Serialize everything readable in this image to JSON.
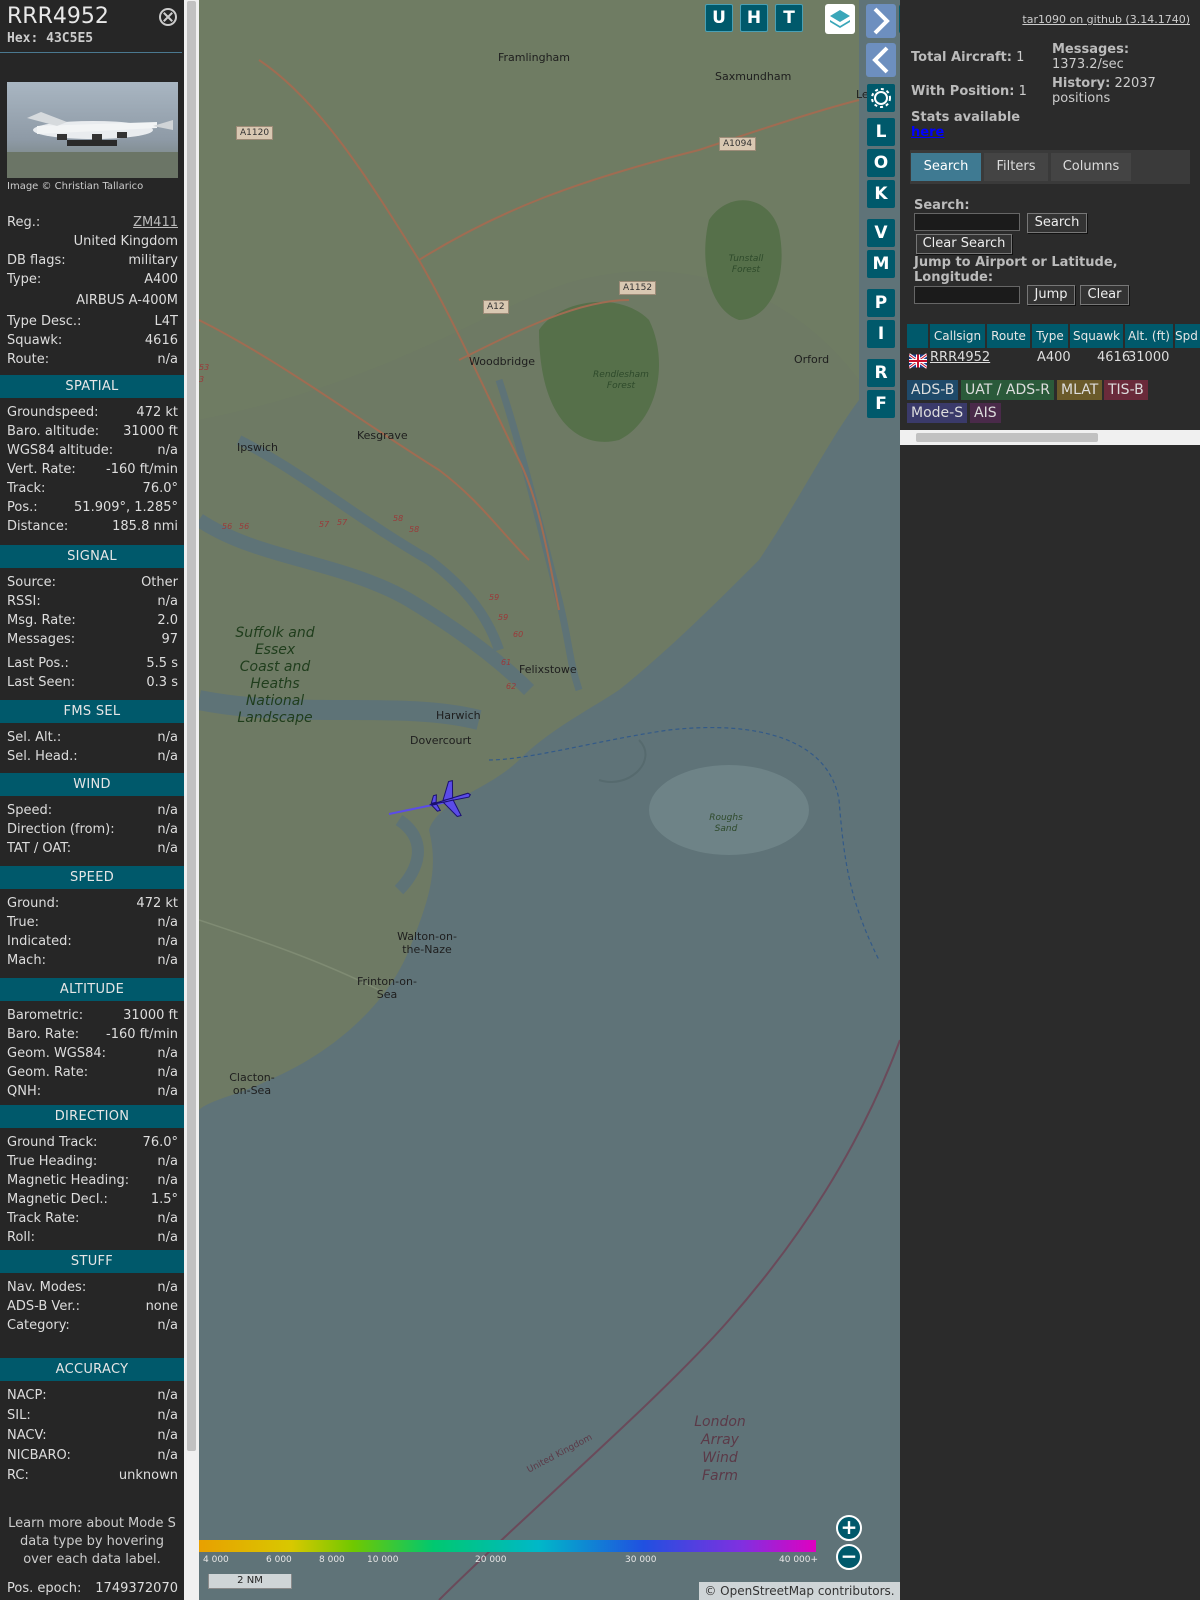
{
  "aircraft": {
    "callsign": "RRR4952",
    "hex_label": "Hex:",
    "hex": "43C5E5",
    "photo_credit": "Image © Christian Tallarico",
    "details": [
      {
        "label": "Reg.:",
        "value": "ZM411",
        "link": true
      },
      {
        "label": "",
        "value": "United Kingdom"
      },
      {
        "label": "DB flags:",
        "value": "military"
      },
      {
        "label": "Type:",
        "value": "A400"
      },
      {
        "label": "",
        "value": "AIRBUS A-400M"
      },
      {
        "label": "Type Desc.:",
        "value": "L4T"
      },
      {
        "label": "Squawk:",
        "value": "4616"
      },
      {
        "label": "Route:",
        "value": "n/a"
      }
    ],
    "sections": [
      {
        "title": "SPATIAL",
        "rows": [
          {
            "label": "Groundspeed:",
            "value": "472 kt"
          },
          {
            "label": "Baro. altitude:",
            "value": "31000 ft"
          },
          {
            "label": "WGS84 altitude:",
            "value": "n/a"
          },
          {
            "label": "Vert. Rate:",
            "value": "-160 ft/min"
          },
          {
            "label": "Track:",
            "value": "76.0°"
          },
          {
            "label": "Pos.:",
            "value": "51.909°, 1.285°"
          },
          {
            "label": "Distance:",
            "value": "185.8 nmi"
          }
        ]
      },
      {
        "title": "SIGNAL",
        "rows": [
          {
            "label": "Source:",
            "value": "Other"
          },
          {
            "label": "RSSI:",
            "value": "n/a"
          },
          {
            "label": "Msg. Rate:",
            "value": "2.0"
          },
          {
            "label": "Messages:",
            "value": "97"
          },
          {
            "label": "Last Pos.:",
            "value": "5.5 s"
          },
          {
            "label": "Last Seen:",
            "value": "0.3 s"
          }
        ]
      },
      {
        "title": "FMS SEL",
        "rows": [
          {
            "label": "Sel. Alt.:",
            "value": "n/a"
          },
          {
            "label": "Sel. Head.:",
            "value": "n/a"
          }
        ]
      },
      {
        "title": "WIND",
        "rows": [
          {
            "label": "Speed:",
            "value": "n/a"
          },
          {
            "label": "Direction (from):",
            "value": "n/a"
          },
          {
            "label": "TAT / OAT:",
            "value": "n/a"
          }
        ]
      },
      {
        "title": "SPEED",
        "rows": [
          {
            "label": "Ground:",
            "value": "472 kt"
          },
          {
            "label": "True:",
            "value": "n/a"
          },
          {
            "label": "Indicated:",
            "value": "n/a"
          },
          {
            "label": "Mach:",
            "value": "n/a"
          }
        ]
      },
      {
        "title": "ALTITUDE",
        "rows": [
          {
            "label": "Barometric:",
            "value": "31000 ft"
          },
          {
            "label": "Baro. Rate:",
            "value": "-160 ft/min"
          },
          {
            "label": "Geom. WGS84:",
            "value": "n/a"
          },
          {
            "label": "Geom. Rate:",
            "value": "n/a"
          },
          {
            "label": "QNH:",
            "value": "n/a"
          }
        ]
      },
      {
        "title": "DIRECTION",
        "rows": [
          {
            "label": "Ground Track:",
            "value": "76.0°"
          },
          {
            "label": "True Heading:",
            "value": "n/a"
          },
          {
            "label": "Magnetic Heading:",
            "value": "n/a"
          },
          {
            "label": "Magnetic Decl.:",
            "value": "1.5°"
          },
          {
            "label": "Track Rate:",
            "value": "n/a"
          },
          {
            "label": "Roll:",
            "value": "n/a"
          }
        ]
      },
      {
        "title": "STUFF",
        "rows": [
          {
            "label": "Nav. Modes:",
            "value": "n/a"
          },
          {
            "label": "ADS-B Ver.:",
            "value": "none"
          },
          {
            "label": "Category:",
            "value": "n/a"
          }
        ]
      },
      {
        "title": "ACCURACY",
        "rows": [
          {
            "label": "NACP:",
            "value": "n/a"
          },
          {
            "label": "SIL:",
            "value": "n/a"
          },
          {
            "label": "NACV:",
            "value": "n/a"
          },
          {
            "label": "NICBARO:",
            "value": "n/a"
          },
          {
            "label": "RC:",
            "value": "unknown"
          }
        ]
      }
    ],
    "learn_more": "Learn more about Mode S data type by hovering over each data label.",
    "pos_epoch_label": "Pos. epoch:",
    "pos_epoch": "1749372070"
  },
  "map": {
    "buttons": [
      "U",
      "H",
      "T"
    ],
    "side_buttons": [
      "L",
      "O",
      "K",
      "V",
      "M",
      "P",
      "I",
      "R",
      "F"
    ],
    "places": [
      "Framlingham",
      "Saxmundham",
      "Le",
      "Woodbridge",
      "Orford",
      "Kesgrave",
      "Ipswich",
      "Felixstowe",
      "Harwich",
      "Dovercourt",
      "Walton-on-the-Naze",
      "Frinton-on-Sea",
      "Clacton-on-Sea"
    ],
    "forests": [
      "Tunstall Forest",
      "Rendlesham Forest",
      "Roughs Sand"
    ],
    "aonb": "Suffolk and Essex Coast and Heaths National Landscape",
    "wind_farm": "London Array Wind Farm",
    "border": "United Kingdom",
    "roads": [
      "A1120",
      "A1094",
      "A12",
      "A1152"
    ],
    "junctions": [
      "56",
      "56",
      "57",
      "57",
      "58",
      "58",
      "59",
      "59",
      "60",
      "61",
      "62",
      "53",
      "3"
    ],
    "altitude_ticks": [
      "4 000",
      "6 000",
      "8 000",
      "10 000",
      "20 000",
      "30 000",
      "40 000+"
    ],
    "scale": "2 NM",
    "attribution": "© OpenStreetMap contributors."
  },
  "panel": {
    "github": "tar1090 on github (3.14.1740)",
    "total_aircraft_label": "Total Aircraft:",
    "total_aircraft": "1",
    "with_position_label": "With Position:",
    "with_position": "1",
    "messages_label": "Messages:",
    "messages": "1373.2/sec",
    "history_label": "History:",
    "history": "22037 positions",
    "stats_label": "Stats available",
    "stats_link": "here",
    "tabs": [
      "Search",
      "Filters",
      "Columns"
    ],
    "search_label": "Search:",
    "search_button": "Search",
    "clear_search_button": "Clear Search",
    "jump_label": "Jump to Airport or Latitude, Longitude:",
    "jump_button": "Jump",
    "clear_button": "Clear",
    "columns": [
      "",
      "Callsign",
      "Route",
      "Type",
      "Squawk",
      "Alt. (ft)",
      "Spd"
    ],
    "rows": [
      {
        "callsign": "RRR4952",
        "route": "",
        "type": "A400",
        "squawk": "4616",
        "alt": "31000"
      }
    ],
    "sources": [
      {
        "label": "ADS-B",
        "color": "#1f4a6a"
      },
      {
        "label": "UAT / ADS-R",
        "color": "#2a5a3a"
      },
      {
        "label": "MLAT",
        "color": "#6a5a2a"
      },
      {
        "label": "TIS-B",
        "color": "#6a2a3a"
      },
      {
        "label": "Mode-S",
        "color": "#3a3a6a"
      },
      {
        "label": "AIS",
        "color": "#4a2a4a"
      }
    ]
  }
}
